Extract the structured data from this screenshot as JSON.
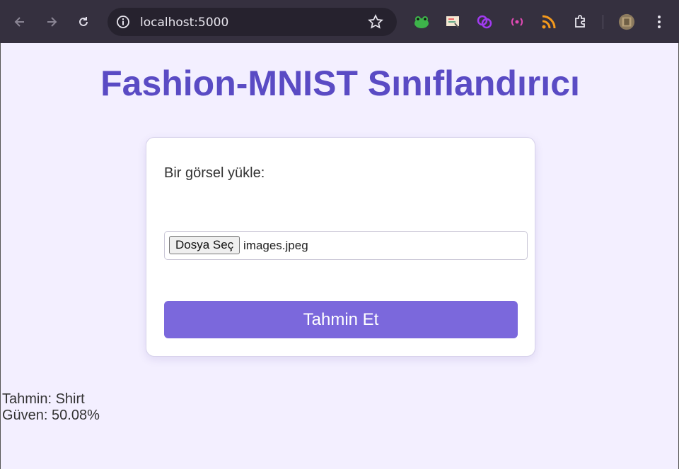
{
  "browser": {
    "url": "localhost:5000",
    "icons": [
      "back-icon",
      "forward-icon",
      "reload-icon",
      "site-info-icon",
      "bookmark-star-icon",
      "extension-frog-icon",
      "extension-screen-icon",
      "extension-link-icon",
      "extension-broadcast-icon",
      "extension-rss-icon",
      "extensions-puzzle-icon",
      "profile-avatar",
      "menu-kebab-icon"
    ]
  },
  "page": {
    "title": "Fashion-MNIST Sınıflandırıcı",
    "upload_label": "Bir görsel yükle:",
    "file_button": "Dosya Seç",
    "file_name": "images.jpeg",
    "submit_label": "Tahmin Et",
    "prediction": "Tahmin: Shirt",
    "confidence": "Güven: 50.08%"
  },
  "colors": {
    "accent": "#5a4bc4",
    "button": "#7b68dc",
    "background": "#f3efff",
    "toolbar": "#35303f"
  }
}
